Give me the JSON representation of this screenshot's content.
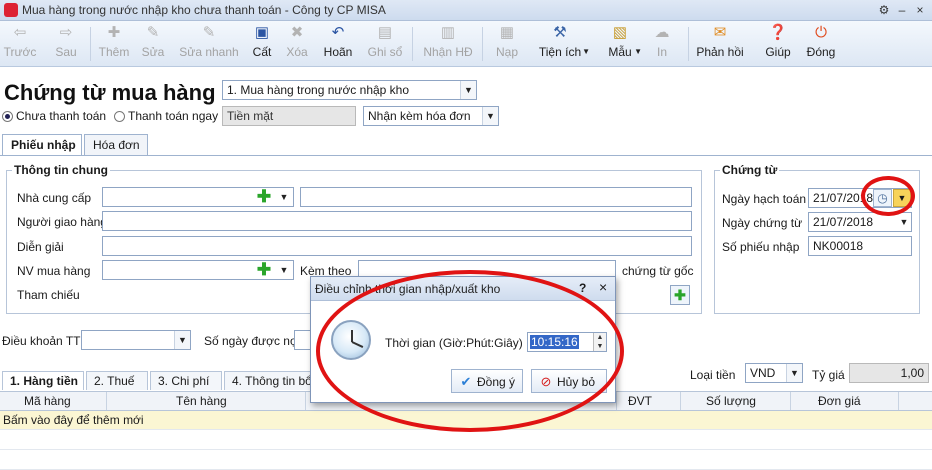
{
  "window": {
    "title": "Mua hàng trong nước nhập kho chưa thanh toán - Công ty CP MISA"
  },
  "toolbar": {
    "items": [
      {
        "label": "Trước",
        "icon": "arrow-left-icon",
        "enabled": false
      },
      {
        "label": "Sau",
        "icon": "arrow-right-icon",
        "enabled": false
      },
      {
        "label": "Thêm",
        "icon": "add-document-icon",
        "enabled": false
      },
      {
        "label": "Sửa",
        "icon": "edit-icon",
        "enabled": false
      },
      {
        "label": "Sửa nhanh",
        "icon": "quick-edit-icon",
        "enabled": false
      },
      {
        "label": "Cất",
        "icon": "save-icon",
        "enabled": true
      },
      {
        "label": "Xóa",
        "icon": "delete-icon",
        "enabled": false
      },
      {
        "label": "Hoãn",
        "icon": "undo-icon",
        "enabled": true
      },
      {
        "label": "Ghi sổ",
        "icon": "post-ledger-icon",
        "enabled": false
      },
      {
        "label": "Nhận HĐ",
        "icon": "receive-invoice-icon",
        "enabled": false
      },
      {
        "label": "Nạp",
        "icon": "reload-icon",
        "enabled": false
      },
      {
        "label": "Tiện ích",
        "icon": "utilities-icon",
        "enabled": true
      },
      {
        "label": "Mẫu",
        "icon": "template-icon",
        "enabled": true
      },
      {
        "label": "In",
        "icon": "print-icon",
        "enabled": false
      },
      {
        "label": "Phản hồi",
        "icon": "feedback-mail-icon",
        "enabled": true
      },
      {
        "label": "Giúp",
        "icon": "help-icon",
        "enabled": true
      },
      {
        "label": "Đóng",
        "icon": "close-icon",
        "enabled": true
      }
    ]
  },
  "header": {
    "title": "Chứng từ mua hàng",
    "type_select": "1. Mua hàng trong nước nhập kho",
    "payment_unpaid": "Chưa thanh toán",
    "payment_now": "Thanh toán ngay",
    "payment_method": "Tiền mặt",
    "invoice_option": "Nhận kèm hóa đơn"
  },
  "tabs": {
    "receipt": "Phiếu nhập",
    "invoice": "Hóa đơn"
  },
  "general": {
    "legend": "Thông tin chung",
    "supplier": "Nhà cung cấp",
    "deliverer": "Người giao hàng",
    "description": "Diễn giải",
    "purchaser": "NV mua hàng",
    "attached": "Kèm theo",
    "original_docs": "chứng từ gốc",
    "reference": "Tham chiếu"
  },
  "voucher": {
    "legend": "Chứng từ",
    "posting_date_label": "Ngày hạch toán",
    "posting_date": "21/07/2018",
    "voucher_date_label": "Ngày chứng từ",
    "voucher_date": "21/07/2018",
    "receipt_no_label": "Số phiếu nhập",
    "receipt_no": "NK00018"
  },
  "terms": {
    "payment_terms": "Điều khoản TT",
    "days_due": "Số ngày được nợ"
  },
  "currency": {
    "label": "Loại tiền",
    "value": "VND",
    "rate_label": "Tỷ giá",
    "rate": "1,00"
  },
  "grid_tabs": [
    "1. Hàng tiền",
    "2. Thuế",
    "3. Chi phí",
    "4. Thông tin bổ"
  ],
  "grid": {
    "columns": [
      "Mã hàng",
      "Tên hàng",
      "ĐVT",
      "Số lượng",
      "Đơn giá"
    ],
    "hint": "Bấm vào đây để thêm mới"
  },
  "dialog": {
    "title": "Điều chỉnh thời gian nhập/xuất kho",
    "help": "?",
    "close": "×",
    "time_label": "Thời gian (Giờ:Phút:Giây)",
    "time_value": "10:15:16",
    "ok": "Đồng ý",
    "cancel": "Hủy bỏ"
  },
  "colors": {
    "annotation_red": "#e01313",
    "toolbar_bg": "#dde7f4",
    "hint_row": "#fbf6d3"
  }
}
